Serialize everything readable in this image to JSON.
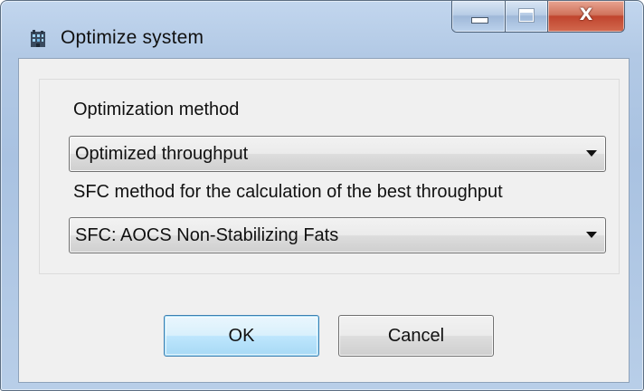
{
  "window": {
    "title": "Optimize system",
    "icon": "app-building-icon",
    "controls": {
      "minimize_icon": "minimize-icon",
      "maximize_icon": "maximize-icon",
      "close_icon": "close-icon",
      "close_glyph": "X"
    }
  },
  "form": {
    "optimization_method": {
      "label": "Optimization method",
      "selected": "Optimized throughput"
    },
    "sfc_method": {
      "label": "SFC method for the calculation of the best throughput",
      "selected": "SFC: AOCS Non-Stabilizing Fats"
    }
  },
  "buttons": {
    "ok": "OK",
    "cancel": "Cancel"
  },
  "colors": {
    "default_button_border": "#3c7fb1",
    "close_button": "#c0452e",
    "frame": "#b2c9e5"
  }
}
